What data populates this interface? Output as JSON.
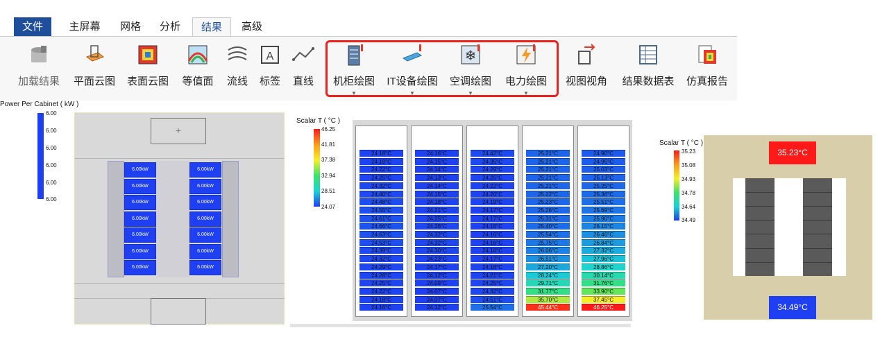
{
  "menu": {
    "tabs": [
      "文件",
      "主屏幕",
      "网格",
      "分析",
      "结果",
      "高级"
    ],
    "active": "结果"
  },
  "ribbon": {
    "buttons": [
      {
        "label": "加载结果",
        "icon": "load-results-icon",
        "disabled": true
      },
      {
        "label": "平面云图",
        "icon": "plane-contour-icon"
      },
      {
        "label": "表面云图",
        "icon": "surface-contour-icon"
      },
      {
        "label": "等值面",
        "icon": "isosurface-icon"
      },
      {
        "label": "流线",
        "icon": "streamline-icon"
      },
      {
        "label": "标签",
        "icon": "label-icon"
      },
      {
        "label": "直线",
        "icon": "line-icon"
      },
      {
        "label": "机柜绘图",
        "icon": "cabinet-plot-icon",
        "dropdown": true
      },
      {
        "label": "IT设备绘图",
        "icon": "it-device-plot-icon",
        "dropdown": true
      },
      {
        "label": "空调绘图",
        "icon": "ac-plot-icon",
        "dropdown": true
      },
      {
        "label": "电力绘图",
        "icon": "power-plot-icon",
        "dropdown": true
      },
      {
        "label": "视图视角",
        "icon": "view-angle-icon"
      },
      {
        "label": "结果数据表",
        "icon": "results-table-icon"
      },
      {
        "label": "仿真报告",
        "icon": "simulation-report-icon"
      }
    ]
  },
  "panel1": {
    "legend_title": "Power Per Cabinet ( kW )",
    "legend_ticks": [
      "6.00",
      "6.00",
      "6.00",
      "6.00",
      "6.00",
      "6.00"
    ],
    "cabinet_label": "6.00kW",
    "cabinets_per_row": 7,
    "legend_color": "#1e3ff2"
  },
  "panel2": {
    "legend_title": "Scalar T ( °C )",
    "legend_ticks": [
      "46.25",
      "41.81",
      "37.38",
      "32.94",
      "28.51",
      "24.07"
    ],
    "range": [
      24.07,
      46.25
    ],
    "racks": [
      [
        "24.18°C",
        "24.19°C",
        "24.22°C",
        "24.25°C",
        "24.32°C",
        "24.40°C",
        "24.48°C",
        "24.55°C",
        "24.61°C",
        "24.66°C",
        "24.63°C",
        "24.53°C",
        "24.39°C",
        "24.32°C",
        "24.29°C",
        "24.28°C",
        "24.25°C",
        "24.22°C",
        "24.18°C",
        "24.16°C"
      ],
      [
        "24.16°C",
        "24.15°C",
        "24.14°C",
        "24.13°C",
        "24.14°C",
        "24.15°C",
        "24.18°C",
        "24.21°C",
        "24.25°C",
        "24.28°C",
        "24.32°C",
        "24.32°C",
        "24.30°C",
        "24.23°C",
        "24.17°C",
        "24.12°C",
        "24.09°C",
        "24.07°C",
        "24.07°C",
        "24.12°C"
      ],
      [
        "24.42°C",
        "24.35°C",
        "24.29°C",
        "24.25°C",
        "24.22°C",
        "24.20°C",
        "24.19°C",
        "24.17°C",
        "24.17°C",
        "24.16°C",
        "24.16°C",
        "24.16°C",
        "24.16°C",
        "24.17°C",
        "24.18°C",
        "24.21°C",
        "24.25°C",
        "24.32°C",
        "24.51°C",
        "25.54°C"
      ],
      [
        "25.21°C",
        "25.21°C",
        "25.21°C",
        "25.21°C",
        "25.21°C",
        "25.22°C",
        "25.23°C",
        "25.26°C",
        "25.31°C",
        "25.40°C",
        "25.54°C",
        "25.75°C",
        "26.06°C",
        "26.51°C",
        "27.20°C",
        "28.24°C",
        "29.71°C",
        "31.77°C",
        "35.70°C",
        "45.44°C"
      ],
      [
        "24.90°C",
        "24.95°C",
        "25.03°C",
        "25.13°C",
        "25.25°C",
        "25.36°C",
        "25.51°C",
        "25.69°C",
        "25.90°C",
        "26.15°C",
        "26.46°C",
        "26.84°C",
        "27.32°C",
        "27.96°C",
        "28.86°C",
        "30.14°C",
        "31.76°C",
        "33.90°C",
        "37.45°C",
        "46.25°C"
      ]
    ]
  },
  "panel3": {
    "legend_title": "Scalar T ( °C )",
    "legend_ticks": [
      "35.23",
      "35.08",
      "34.93",
      "34.78",
      "34.64",
      "34.49"
    ],
    "top_label": "35.23°C",
    "bottom_label": "34.49°C"
  },
  "colors": {
    "menu_active": "#1f4e9a",
    "highlight": "#e8231d",
    "hot": "#ff2a1a",
    "cold": "#1e3ff2"
  }
}
